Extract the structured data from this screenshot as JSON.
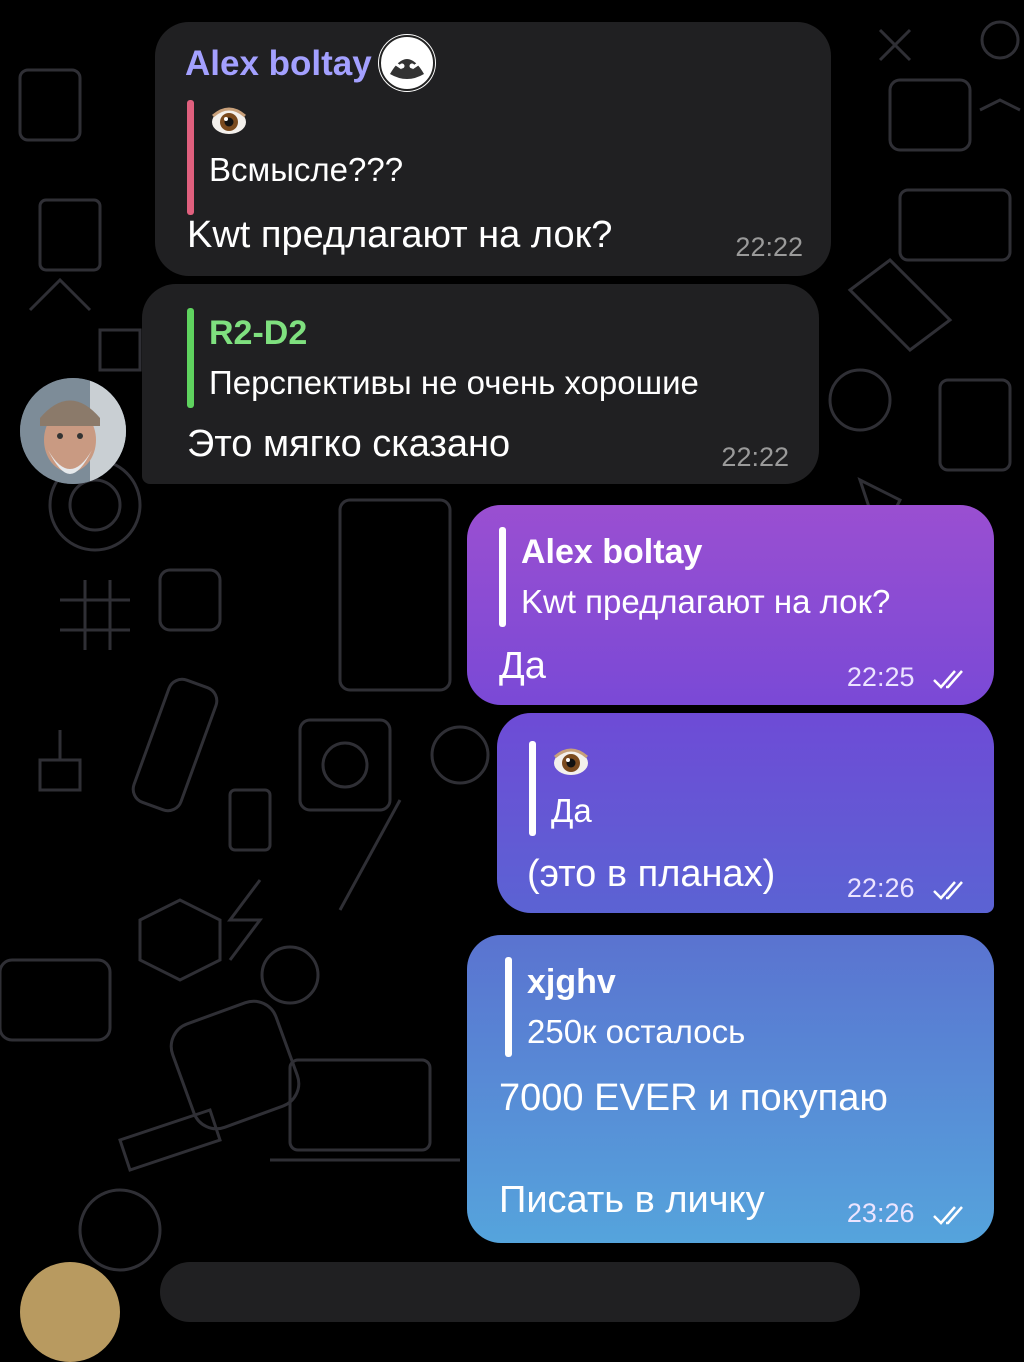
{
  "messages": [
    {
      "id": "m1",
      "sender": "Alex boltay",
      "quote_text": "Всмысле???",
      "text": "Kwt  предлагают на лок?",
      "time": "22:22"
    },
    {
      "id": "m2",
      "quote_name": "R2-D2",
      "quote_text": "Перспективы не очень хорошие",
      "text": "Это мягко сказано",
      "time": "22:22"
    },
    {
      "id": "m3",
      "quote_name": "Alex boltay",
      "quote_text": "Kwt  предлагают на лок?",
      "text": "Да",
      "time": "22:25"
    },
    {
      "id": "m4",
      "quote_text": "Да",
      "text": "(это в планах)",
      "time": "22:26"
    },
    {
      "id": "m5",
      "quote_name": "xjghv",
      "quote_text": "250к осталось",
      "text": "7000 EVER и покупаю",
      "text2": "Писать в личку",
      "time": "23:26"
    }
  ],
  "colors": {
    "incoming_bubble": "#202022",
    "sender_name": "#a3a0ff",
    "quote_bar_pink": "#e0607e",
    "quote_bar_green": "#5fd35f",
    "r2d2_name": "#7fe07f"
  },
  "icons": [
    "eye-emoji-icon",
    "double-check-icon",
    "raccoon-badge-icon"
  ]
}
